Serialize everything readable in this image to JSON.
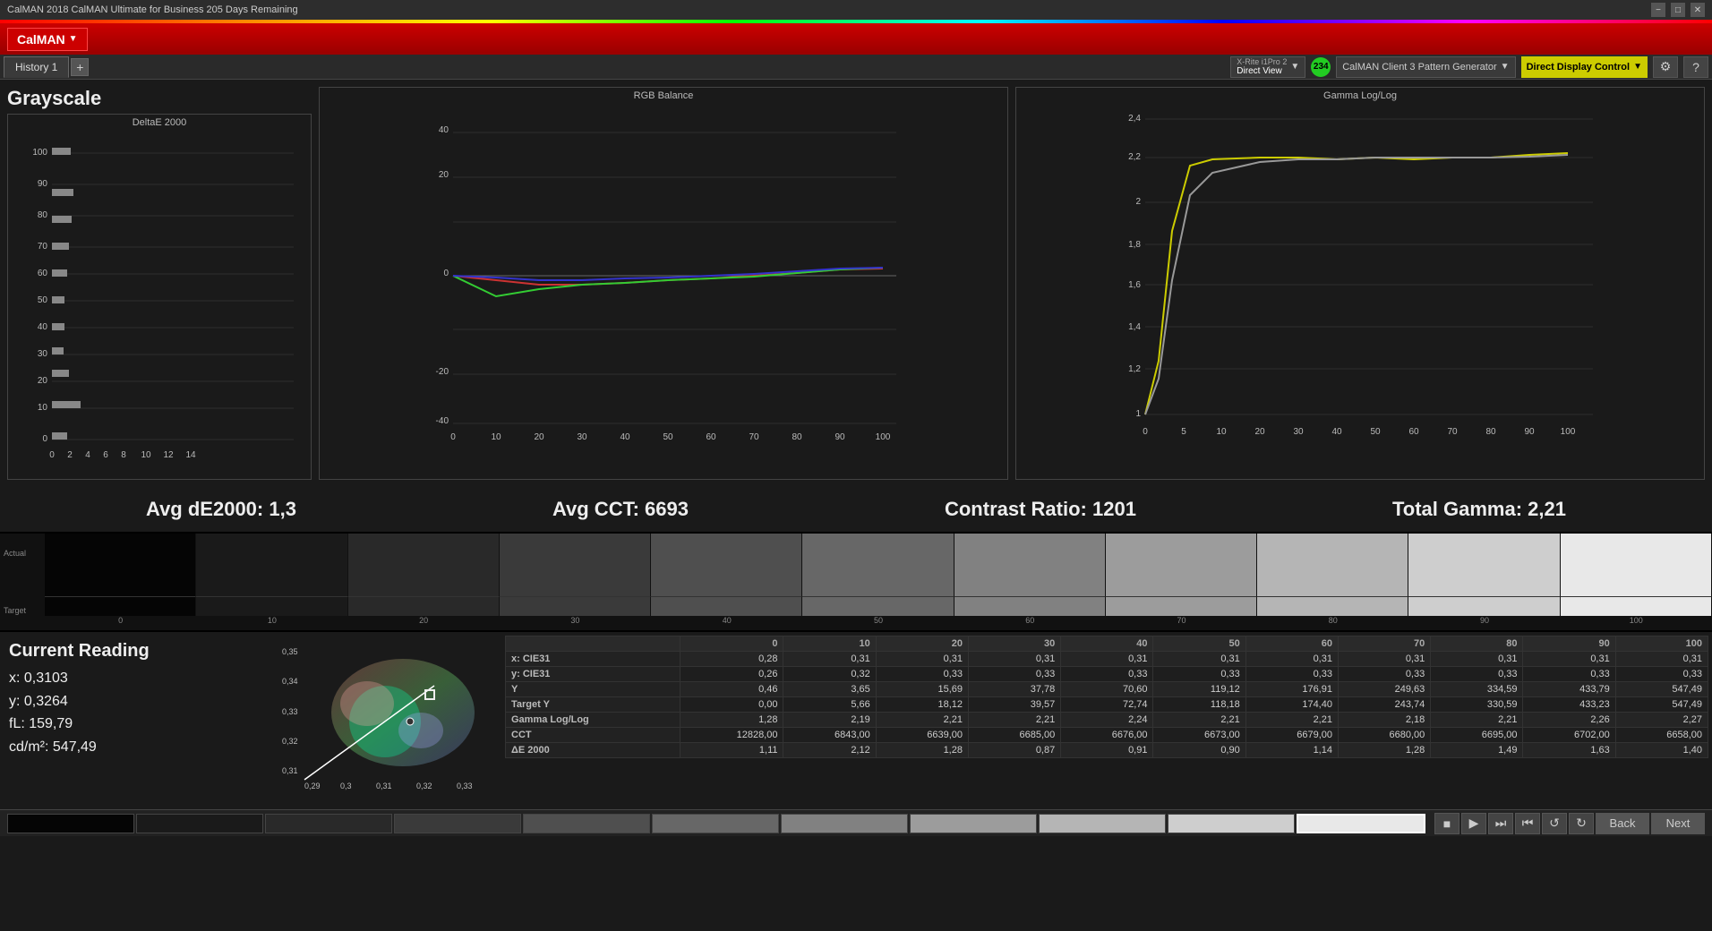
{
  "titleBar": {
    "title": "CalMAN 2018 CalMAN Ultimate for Business 205 Days Remaining",
    "minBtn": "−",
    "maxBtn": "□",
    "closeBtn": "✕"
  },
  "menuBar": {
    "logo": "CalMAN",
    "dropArrow": "▼"
  },
  "tabs": [
    {
      "id": "history1",
      "label": "History 1",
      "active": true
    }
  ],
  "topControls": {
    "device1Label1": "X-Rite i1Pro 2",
    "device1Label2": "Direct View",
    "circleValue": "234",
    "device2Label": "CalMAN Client 3 Pattern Generator",
    "device3Label": "Direct Display Control",
    "settingsIcon": "⚙",
    "helpIcon": "?"
  },
  "grayscale": {
    "title": "Grayscale",
    "deltaETitle": "DeltaE 2000",
    "avgDE": "Avg dE2000: 1,3",
    "avgCCT": "Avg CCT: 6693",
    "contrastRatio": "Contrast Ratio: 1201",
    "totalGamma": "Total Gamma: 2,21"
  },
  "currentReading": {
    "title": "Current Reading",
    "x": "x: 0,3103",
    "y": "y: 0,3264",
    "fL": "fL: 159,79",
    "cdm2": "cd/m²: 547,49"
  },
  "dataTable": {
    "columns": [
      "",
      "0",
      "10",
      "20",
      "30",
      "40",
      "50",
      "60",
      "70",
      "80",
      "90",
      "100"
    ],
    "rows": [
      {
        "label": "x: CIE31",
        "values": [
          "0,28",
          "0,31",
          "0,31",
          "0,31",
          "0,31",
          "0,31",
          "0,31",
          "0,31",
          "0,31",
          "0,31",
          "0,31"
        ]
      },
      {
        "label": "y: CIE31",
        "values": [
          "0,26",
          "0,32",
          "0,33",
          "0,33",
          "0,33",
          "0,33",
          "0,33",
          "0,33",
          "0,33",
          "0,33",
          "0,33"
        ]
      },
      {
        "label": "Y",
        "values": [
          "0,46",
          "3,65",
          "15,69",
          "37,78",
          "70,60",
          "119,12",
          "176,91",
          "249,63",
          "334,59",
          "433,79",
          "547,49"
        ]
      },
      {
        "label": "Target Y",
        "values": [
          "0,00",
          "5,66",
          "18,12",
          "39,57",
          "72,74",
          "118,18",
          "174,40",
          "243,74",
          "330,59",
          "433,23",
          "547,49"
        ]
      },
      {
        "label": "Gamma Log/Log",
        "values": [
          "1,28",
          "2,19",
          "2,21",
          "2,21",
          "2,24",
          "2,21",
          "2,21",
          "2,18",
          "2,21",
          "2,26",
          "2,27"
        ]
      },
      {
        "label": "CCT",
        "values": [
          "12828,00",
          "6843,00",
          "6639,00",
          "6685,00",
          "6676,00",
          "6673,00",
          "6679,00",
          "6680,00",
          "6695,00",
          "6702,00",
          "6658,00"
        ]
      },
      {
        "label": "ΔE 2000",
        "values": [
          "1,11",
          "2,12",
          "1,28",
          "0,87",
          "0,91",
          "0,90",
          "1,14",
          "1,28",
          "1,49",
          "1,63",
          "1,40"
        ]
      }
    ]
  },
  "swatchLabels": [
    "0",
    "10",
    "20",
    "30",
    "40",
    "50",
    "60",
    "70",
    "80",
    "90",
    "100"
  ],
  "swatchColors": [
    "#050505",
    "#1a1a1a",
    "#292929",
    "#3a3a3a",
    "#4f4f4f",
    "#676767",
    "#818181",
    "#9c9c9c",
    "#b5b5b5",
    "#cecece",
    "#e8e8e8"
  ],
  "bottomNav": {
    "backLabel": "Back",
    "nextLabel": "Next"
  }
}
